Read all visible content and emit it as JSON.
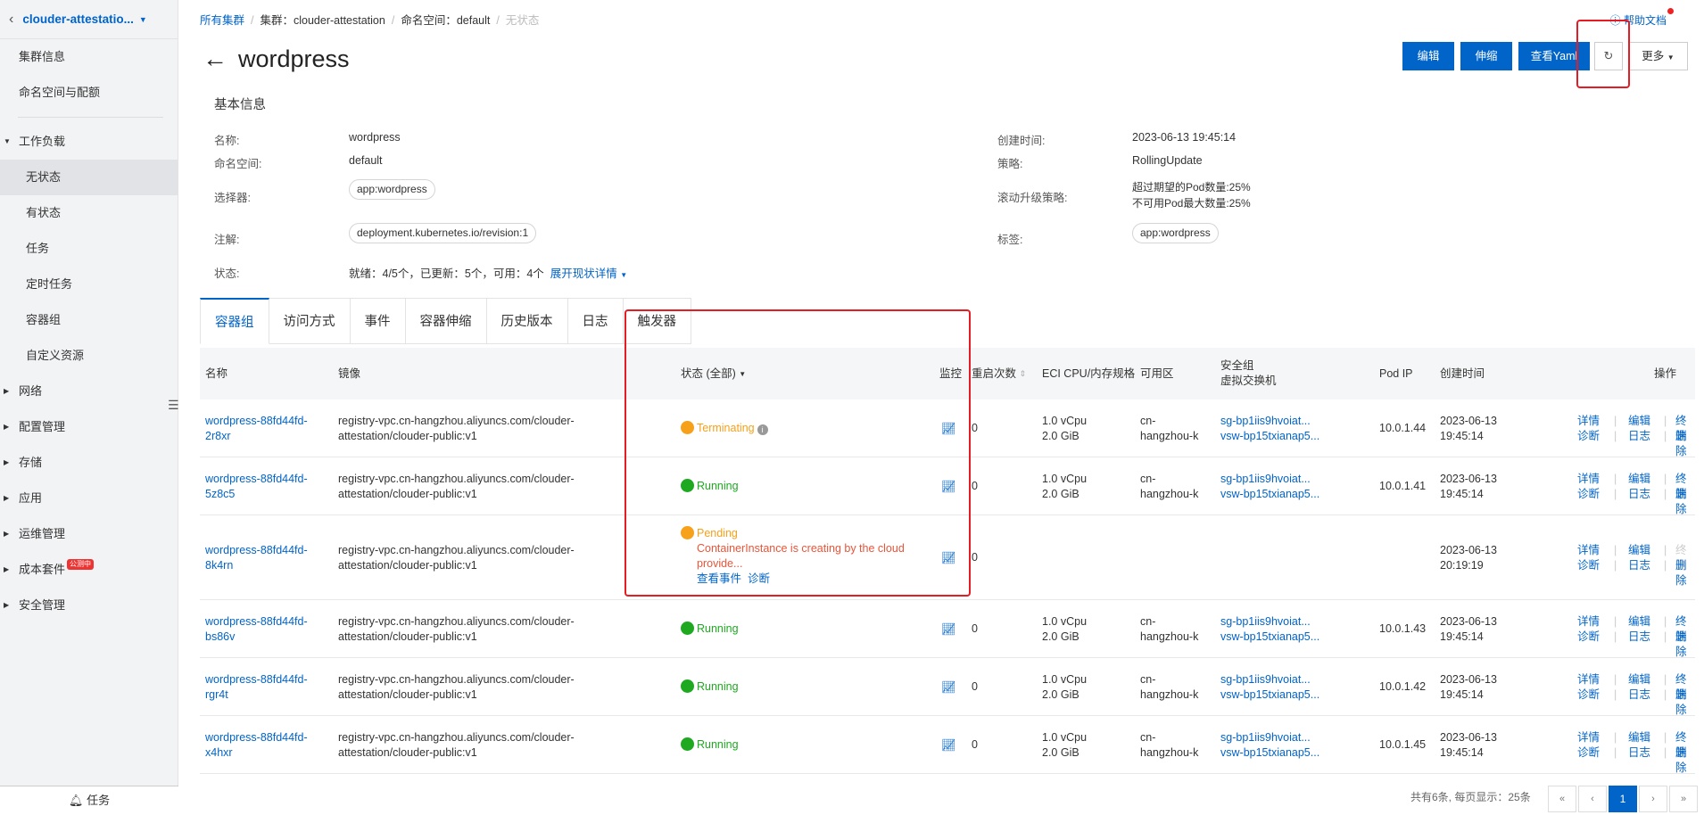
{
  "sidebar": {
    "cluster_name": "clouder-attestatio...",
    "top_items": [
      {
        "label": "集群信息"
      },
      {
        "label": "命名空间与配额"
      }
    ],
    "workload_group": "工作负载",
    "workload_items": [
      {
        "label": "无状态",
        "active": true
      },
      {
        "label": "有状态"
      },
      {
        "label": "任务"
      },
      {
        "label": "定时任务"
      },
      {
        "label": "容器组"
      },
      {
        "label": "自定义资源"
      }
    ],
    "groups": [
      {
        "label": "网络"
      },
      {
        "label": "配置管理"
      },
      {
        "label": "存储"
      },
      {
        "label": "应用"
      },
      {
        "label": "运维管理"
      },
      {
        "label": "成本套件",
        "badge": "公测中"
      },
      {
        "label": "安全管理"
      }
    ],
    "footer": "任务"
  },
  "breadcrumb": {
    "all_clusters": "所有集群",
    "cluster": "集群：clouder-attestation",
    "namespace": "命名空间：default",
    "current": "无状态"
  },
  "help": "帮助文档",
  "title": "wordpress",
  "toolbar": {
    "edit": "编辑",
    "scale": "伸缩",
    "view_yaml": "查看Yaml",
    "more": "更多"
  },
  "info": {
    "section_title": "基本信息",
    "name_label": "名称:",
    "name": "wordpress",
    "namespace_label": "命名空间:",
    "namespace": "default",
    "selector_label": "选择器:",
    "selector": "app:wordpress",
    "annotation_label": "注解:",
    "annotation": "deployment.kubernetes.io/revision:1",
    "status_label": "状态:",
    "status": "就绪：4/5个，已更新：5个，可用：4个",
    "status_expand": "展开现状详情",
    "created_label": "创建时间:",
    "created": "2023-06-13 19:45:14",
    "strategy_label": "策略:",
    "strategy": "RollingUpdate",
    "rolling_label": "滚动升级策略:",
    "rolling_1": "超过期望的Pod数量:25%",
    "rolling_2": "不可用Pod最大数量:25%",
    "labels_label": "标签:",
    "labels": "app:wordpress"
  },
  "tabs": [
    {
      "label": "容器组",
      "active": true
    },
    {
      "label": "访问方式"
    },
    {
      "label": "事件"
    },
    {
      "label": "容器伸缩"
    },
    {
      "label": "历史版本"
    },
    {
      "label": "日志"
    },
    {
      "label": "触发器"
    }
  ],
  "table": {
    "headers": {
      "name": "名称",
      "image": "镜像",
      "status": "状态 (全部)",
      "monitor": "监控",
      "restarts": "重启次数",
      "eci": "ECI CPU/内存规格",
      "zone": "可用区",
      "sg_1": "安全组",
      "sg_2": "虚拟交换机",
      "pod_ip": "Pod IP",
      "created": "创建时间",
      "ops": "操作"
    },
    "rows": [
      {
        "name_1": "wordpress-88fd44fd-",
        "name_2": "2r8xr",
        "image_1": "registry-vpc.cn-hangzhou.aliyuncs.com/clouder-",
        "image_2": "attestation/clouder-public:v1",
        "status": "Terminating",
        "status_kind": "warn",
        "restarts": "0",
        "cpu": "1.0 vCpu",
        "mem": "2.0 GiB",
        "zone_1": "cn-",
        "zone_2": "hangzhou-k",
        "sg": "sg-bp1iis9hvoiat...",
        "vsw": "vsw-bp15txianap5...",
        "ip": "10.0.1.44",
        "date": "2023-06-13",
        "time": "19:45:14"
      },
      {
        "name_1": "wordpress-88fd44fd-",
        "name_2": "5z8c5",
        "image_1": "registry-vpc.cn-hangzhou.aliyuncs.com/clouder-",
        "image_2": "attestation/clouder-public:v1",
        "status": "Running",
        "status_kind": "ok",
        "restarts": "0",
        "cpu": "1.0 vCpu",
        "mem": "2.0 GiB",
        "zone_1": "cn-",
        "zone_2": "hangzhou-k",
        "sg": "sg-bp1iis9hvoiat...",
        "vsw": "vsw-bp15txianap5...",
        "ip": "10.0.1.41",
        "date": "2023-06-13",
        "time": "19:45:14"
      },
      {
        "name_1": "wordpress-88fd44fd-",
        "name_2": "8k4rn",
        "image_1": "registry-vpc.cn-hangzhou.aliyuncs.com/clouder-",
        "image_2": "attestation/clouder-public:v1",
        "status": "Pending",
        "status_kind": "warn",
        "error_1": "ContainerInstance is creating by the cloud",
        "error_2": "provide...",
        "view_events": "查看事件",
        "diagnose": "诊断",
        "restarts": "0",
        "date": "2023-06-13",
        "time": "20:19:19"
      },
      {
        "name_1": "wordpress-88fd44fd-",
        "name_2": "bs86v",
        "image_1": "registry-vpc.cn-hangzhou.aliyuncs.com/clouder-",
        "image_2": "attestation/clouder-public:v1",
        "status": "Running",
        "status_kind": "ok",
        "restarts": "0",
        "cpu": "1.0 vCpu",
        "mem": "2.0 GiB",
        "zone_1": "cn-",
        "zone_2": "hangzhou-k",
        "sg": "sg-bp1iis9hvoiat...",
        "vsw": "vsw-bp15txianap5...",
        "ip": "10.0.1.43",
        "date": "2023-06-13",
        "time": "19:45:14"
      },
      {
        "name_1": "wordpress-88fd44fd-",
        "name_2": "rgr4t",
        "image_1": "registry-vpc.cn-hangzhou.aliyuncs.com/clouder-",
        "image_2": "attestation/clouder-public:v1",
        "status": "Running",
        "status_kind": "ok",
        "restarts": "0",
        "cpu": "1.0 vCpu",
        "mem": "2.0 GiB",
        "zone_1": "cn-",
        "zone_2": "hangzhou-k",
        "sg": "sg-bp1iis9hvoiat...",
        "vsw": "vsw-bp15txianap5...",
        "ip": "10.0.1.42",
        "date": "2023-06-13",
        "time": "19:45:14"
      },
      {
        "name_1": "wordpress-88fd44fd-",
        "name_2": "x4hxr",
        "image_1": "registry-vpc.cn-hangzhou.aliyuncs.com/clouder-",
        "image_2": "attestation/clouder-public:v1",
        "status": "Running",
        "status_kind": "ok",
        "restarts": "0",
        "cpu": "1.0 vCpu",
        "mem": "2.0 GiB",
        "zone_1": "cn-",
        "zone_2": "hangzhou-k",
        "sg": "sg-bp1iis9hvoiat...",
        "vsw": "vsw-bp15txianap5...",
        "ip": "10.0.1.45",
        "date": "2023-06-13",
        "time": "19:45:14"
      }
    ],
    "ops": {
      "detail": "详情",
      "edit": "编辑",
      "terminate": "终端",
      "diagnose": "诊断",
      "log": "日志",
      "delete": "删除"
    }
  },
  "pagination": {
    "summary": "共有6条, 每页显示：25条",
    "first": "«",
    "prev": "‹",
    "current": "1",
    "next": "›",
    "last": "»"
  },
  "colors": {
    "primary": "#0064c8",
    "running": "#1ea920",
    "pending": "#f7a019",
    "error_text": "#e8553a",
    "highlight_box": "#e51c23"
  }
}
